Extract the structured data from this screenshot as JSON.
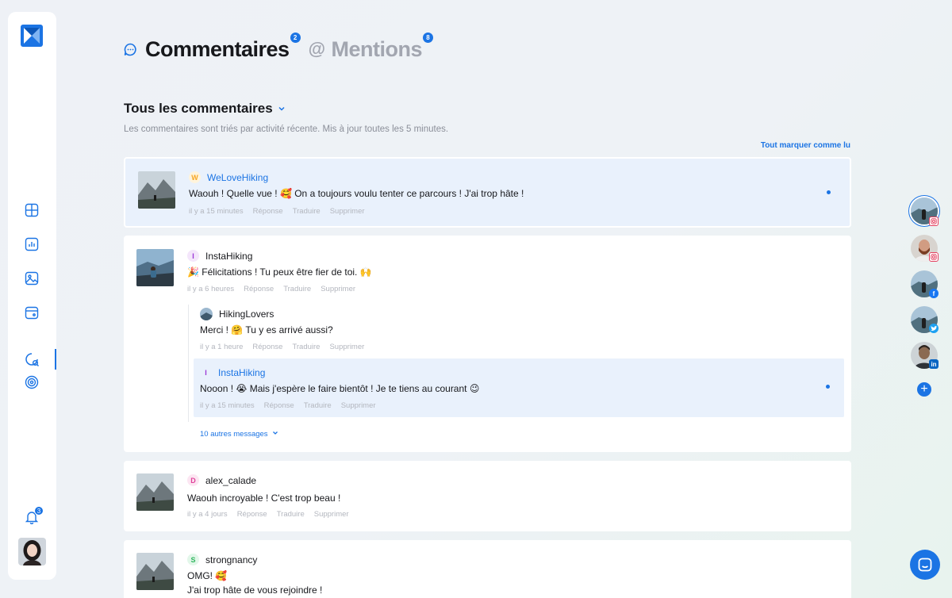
{
  "nav": {
    "notifications_count": "3"
  },
  "tabs": {
    "comments": {
      "label": "Commentaires",
      "count": "2"
    },
    "mentions": {
      "label": "Mentions",
      "count": "8"
    }
  },
  "filter": {
    "title": "Tous les commentaires",
    "subtitle": "Les commentaires sont triés par activité récente. Mis à jour toutes les 5 minutes.",
    "mark_all": "Tout marquer comme lu"
  },
  "actions": {
    "reply": "Réponse",
    "translate": "Traduire",
    "delete": "Supprimer"
  },
  "comments": [
    {
      "initial": "W",
      "author": "WeLoveHiking",
      "text": "Waouh ! Quelle vue ! 🥰 On a toujours voulu tenter ce parcours ! J'ai trop hâte !",
      "time": "il y a 15 minutes",
      "unread": true
    },
    {
      "initial": "I",
      "author": "InstaHiking",
      "text": "🎉 Félicitations ! Tu peux être fier de toi. 🙌",
      "time": "il y a 6 heures",
      "replies": [
        {
          "author": "HikingLovers",
          "text": "Merci ! 🤗 Tu y es arrivé aussi?",
          "time": "il y a 1 heure"
        },
        {
          "initial": "I",
          "author": "InstaHiking",
          "text": "Nooon ! 😭 Mais j'espère le faire bientôt ! Je te tiens au courant 😉",
          "time": "il y a 15 minutes",
          "unread": true
        }
      ],
      "more_messages": "10 autres messages"
    },
    {
      "initial": "D",
      "author": "alex_calade",
      "text": "Waouh incroyable ! C'est trop beau !",
      "time": "il y a 4 jours"
    },
    {
      "initial": "S",
      "author": "strongnancy",
      "text_line1": "OMG! 🥰",
      "text_line2": "J'ai trop hâte de vous rejoindre !"
    }
  ],
  "colors": {
    "accent": "#1b74e4",
    "unread_bg": "#e9f1fc",
    "initial_w": "#f6a623",
    "initial_i": "#9b37d6",
    "initial_d": "#e0409a",
    "initial_s": "#2fb55d"
  },
  "accounts": [
    {
      "network": "instagram-icon",
      "selected": true
    },
    {
      "network": "instagram-icon"
    },
    {
      "network": "facebook-icon"
    },
    {
      "network": "twitter-icon"
    },
    {
      "network": "linkedin-icon"
    }
  ]
}
